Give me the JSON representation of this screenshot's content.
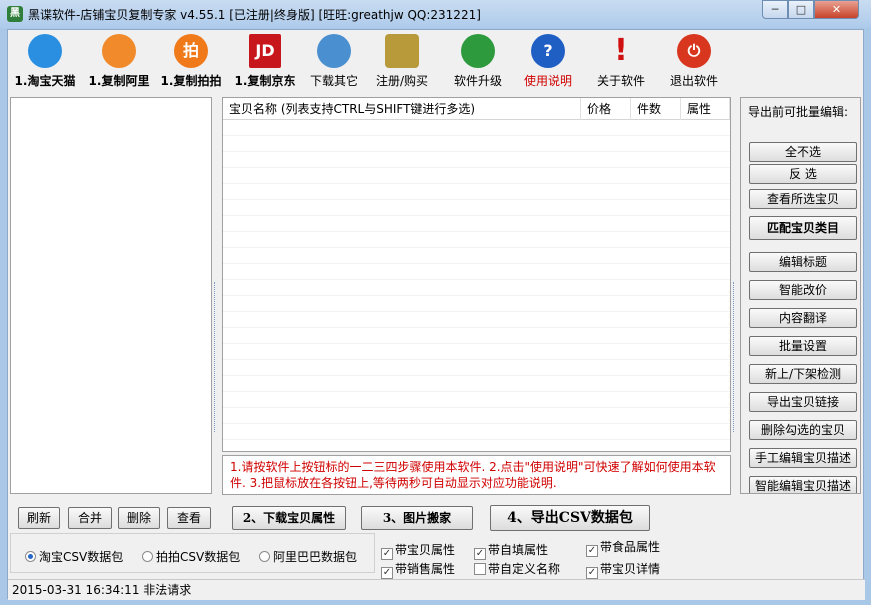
{
  "window": {
    "title": "黑谍软件-店铺宝贝复制专家  v4.55.1 [已注册|终身版] [旺旺:greathjw QQ:231221]",
    "min_glyph": "─",
    "max_glyph": "□",
    "close_glyph": "✕"
  },
  "toolbar": [
    {
      "id": "tb-taobao",
      "label": "1.淘宝天猫",
      "icon": "taobao-icon",
      "glyph": "",
      "color": "#2a8fe0",
      "bold": true
    },
    {
      "id": "tb-alibaba",
      "label": "1.复制阿里",
      "icon": "alibaba-icon",
      "glyph": "",
      "color": "#f08a2a",
      "bold": true
    },
    {
      "id": "tb-paipai",
      "label": "1.复制拍拍",
      "icon": "paipai-icon",
      "glyph": "拍",
      "color": "#f07a1a",
      "bold": true
    },
    {
      "id": "tb-jd",
      "label": "1.复制京东",
      "icon": "jd-icon",
      "glyph": "JD",
      "color": "#c8161d",
      "bold": true
    },
    {
      "id": "tb-download",
      "label": "下载其它",
      "icon": "computer-globe-icon",
      "glyph": "",
      "color": "#4a8fd0",
      "bold": false
    },
    {
      "id": "tb-register",
      "label": "注册/购买",
      "icon": "keys-icon",
      "glyph": "",
      "color": "#b89a3a",
      "bold": false
    },
    {
      "id": "tb-upgrade",
      "label": "软件升级",
      "icon": "upgrade-globe-icon",
      "glyph": "",
      "color": "#2e9a3e",
      "bold": false
    },
    {
      "id": "tb-help",
      "label": "使用说明",
      "icon": "help-icon",
      "glyph": "?",
      "color": "#1f5fc4",
      "bold": false,
      "red": true
    },
    {
      "id": "tb-about",
      "label": "关于软件",
      "icon": "exclamation-icon",
      "glyph": "!",
      "color": "#d01010",
      "bold": false
    },
    {
      "id": "tb-exit",
      "label": "退出软件",
      "icon": "power-icon",
      "glyph": "⏻",
      "color": "#d8361e",
      "bold": false
    }
  ],
  "list": {
    "columns": [
      "宝贝名称 (列表支持CTRL与SHIFT键进行多选)",
      "价格",
      "件数",
      "属性"
    ],
    "rows": []
  },
  "hint": "1.请按软件上按钮标的一二三四步骤使用本软件. 2.点击\"使用说明\"可快速了解如何使用本软件. 3.把鼠标放在各按钮上,等待两秒可自动显示对应功能说明.",
  "right_panel": {
    "title": "导出前可批量编辑:",
    "buttons": [
      {
        "label": "全不选",
        "big": false
      },
      {
        "label": "反 选",
        "big": false
      },
      {
        "label": "查看所选宝贝",
        "big": false
      },
      {
        "label": "匹配宝贝类目",
        "big": true
      },
      {
        "label": "编辑标题",
        "big": false
      },
      {
        "label": "智能改价",
        "big": false
      },
      {
        "label": "内容翻译",
        "big": false
      },
      {
        "label": "批量设置",
        "big": false
      },
      {
        "label": "新上/下架检测",
        "big": false
      },
      {
        "label": "导出宝贝链接",
        "big": false
      },
      {
        "label": "删除勾选的宝贝",
        "big": false
      },
      {
        "label": "手工编辑宝贝描述",
        "big": false
      },
      {
        "label": "智能编辑宝贝描述",
        "big": false
      }
    ]
  },
  "bottom_buttons": {
    "refresh": "刷新",
    "merge": "合并",
    "delete": "删除",
    "view": "查看",
    "step2": "2、下载宝贝属性",
    "step3": "3、图片搬家",
    "step4": "4、导出CSV数据包"
  },
  "radios": [
    {
      "label": "淘宝CSV数据包",
      "checked": true
    },
    {
      "label": "拍拍CSV数据包",
      "checked": false
    },
    {
      "label": "阿里巴巴数据包",
      "checked": false
    }
  ],
  "checkboxes": [
    {
      "label": "带宝贝属性",
      "checked": true
    },
    {
      "label": "带自填属性",
      "checked": true
    },
    {
      "label": "带食品属性",
      "checked": true
    },
    {
      "label": "带销售属性",
      "checked": true
    },
    {
      "label": "带自定义名称",
      "checked": false
    },
    {
      "label": "带宝贝详情",
      "checked": true
    }
  ],
  "status": "2015-03-31 16:34:11 非法请求"
}
